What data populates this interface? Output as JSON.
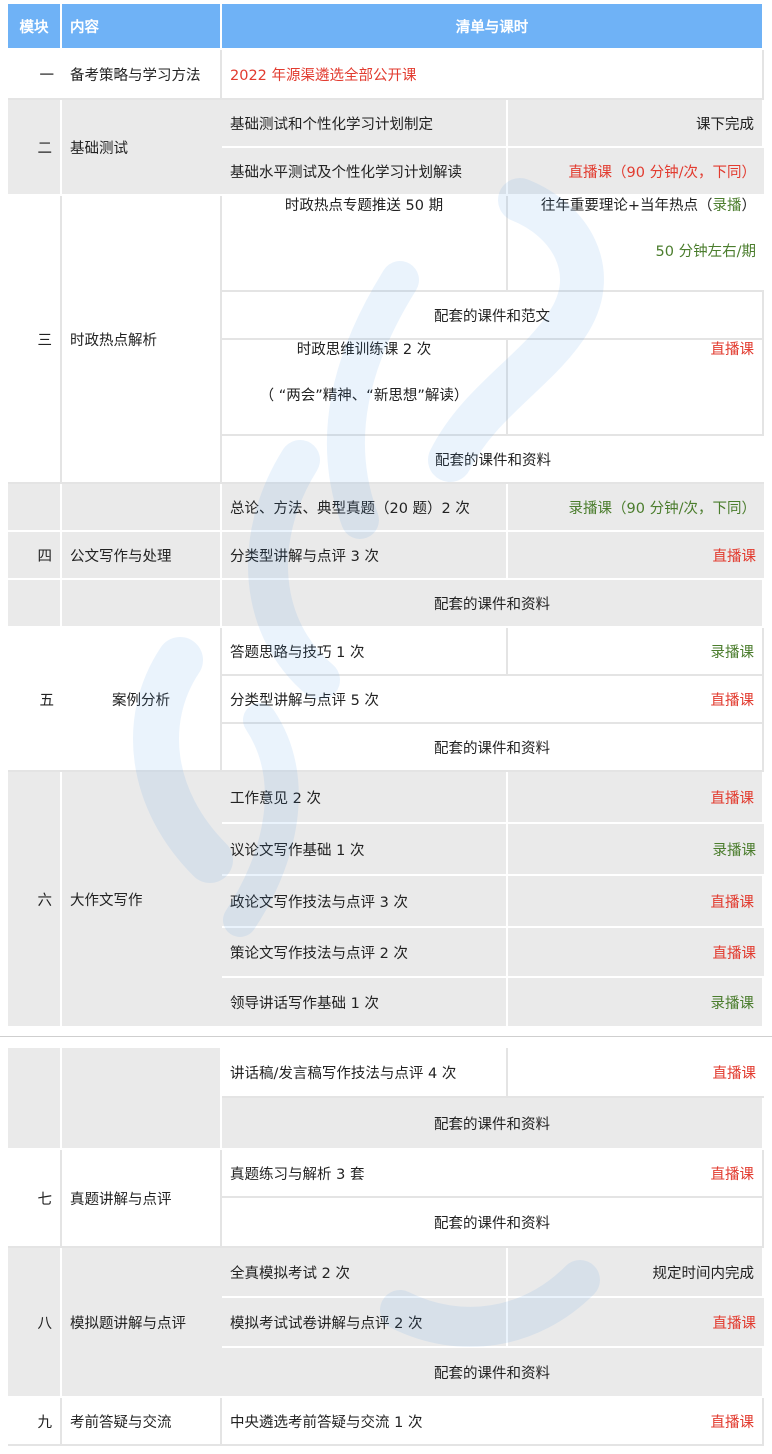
{
  "header": {
    "col1": "模块",
    "col2": "内容",
    "col3": "清单与课时"
  },
  "rows": {
    "m1": {
      "num": "一",
      "name": "备考策略与学习方法",
      "item": "2022 年源渠遴选全部公开课"
    },
    "m2": {
      "num": "二",
      "name": "基础测试",
      "i1": "基础测试和个性化学习计划制定",
      "i1_note": "课下完成",
      "i2": "基础水平测试及个性化学习计划解读",
      "i2_note": "直播课（90 分钟/次，下同）"
    },
    "m3": {
      "num": "三",
      "name": "时政热点解析",
      "i1": "时政热点专题推送 50 期",
      "i1_note_a": "往年重要理论+当年热点（",
      "i1_note_b": "录播",
      "i1_note_c": "）",
      "i1_note_d": "50 分钟左右/期",
      "mat1": "配套的课件和范文",
      "i2_a": "时政思维训练课 2 次",
      "i2_b": "（ “两会”精神、“新思想”解读）",
      "i2_note": "直播课",
      "mat2": "配套的课件和资料"
    },
    "m4": {
      "num": "四",
      "name": "公文写作与处理",
      "i1": "总论、方法、典型真题（20 题）2 次",
      "i1_note": "录播课（90 分钟/次，下同）",
      "i2": "分类型讲解与点评 3 次",
      "i2_note": "直播课",
      "mat": "配套的课件和资料"
    },
    "m5": {
      "num": "五",
      "name": "案例分析",
      "i1": "答题思路与技巧 1 次",
      "i1_note": "录播课",
      "i2": "分类型讲解与点评 5 次",
      "i2_note": "直播课",
      "mat": "配套的课件和资料"
    },
    "m6": {
      "num": "六",
      "name": "大作文写作",
      "i1": "工作意见 2 次",
      "i1_note": "直播课",
      "i2": "议论文写作基础 1 次",
      "i2_note": "录播课",
      "i3": "政论文写作技法与点评 3 次",
      "i3_note": "直播课",
      "i4": "策论文写作技法与点评 2 次",
      "i4_note": "直播课",
      "i5": "领导讲话写作基础 1 次",
      "i5_note": "录播课",
      "i6": "讲话稿/发言稿写作技法与点评 4 次",
      "i6_note": "直播课",
      "mat": "配套的课件和资料"
    },
    "m7": {
      "num": "七",
      "name": "真题讲解与点评",
      "i1": "真题练习与解析 3 套",
      "i1_note": "直播课",
      "mat": "配套的课件和资料"
    },
    "m8": {
      "num": "八",
      "name": "模拟题讲解与点评",
      "i1": "全真模拟考试 2 次",
      "i1_note": "规定时间内完成",
      "i2": "模拟考试试卷讲解与点评 2 次",
      "i2_note": "直播课",
      "mat": "配套的课件和资料"
    },
    "m9": {
      "num": "九",
      "name": "考前答疑与交流",
      "i1": "中央遴选考前答疑与交流 1 次",
      "i1_note": "直播课"
    }
  },
  "colors": {
    "header_bg": "#6fb2f6",
    "row_gray": "#eaeaea",
    "live": "#e23b2f",
    "recorded": "#4b7d2d"
  },
  "watermark": {
    "icon": "brush-calligraphy-watermark"
  }
}
